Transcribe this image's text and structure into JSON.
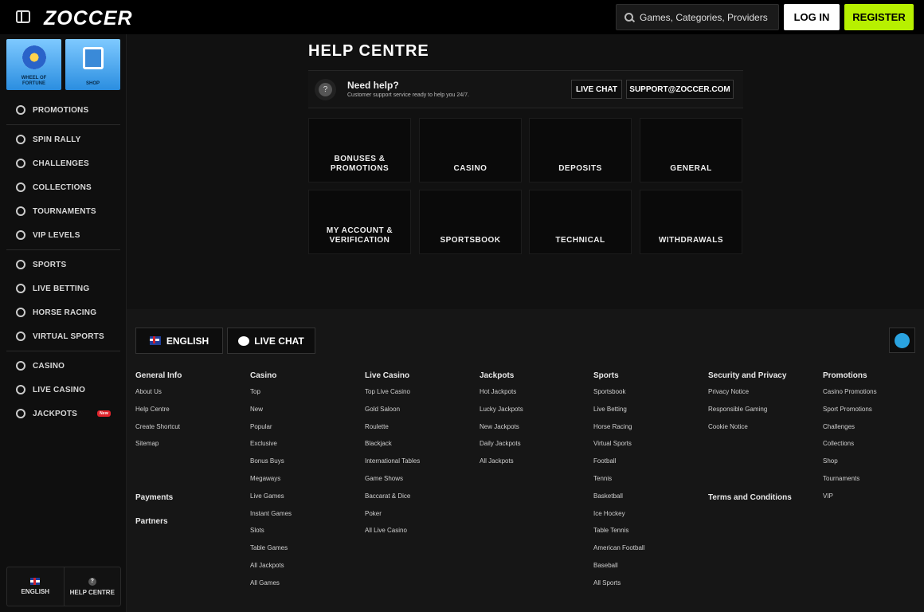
{
  "header": {
    "logo": "ZOCCER",
    "search_placeholder": "Games, Categories, Providers",
    "login": "LOG IN",
    "register": "REGISTER"
  },
  "sidebar": {
    "tiles": [
      {
        "label": "WHEEL OF FORTUNE"
      },
      {
        "label": "SHOP"
      }
    ],
    "groups": [
      [
        {
          "label": "PROMOTIONS",
          "icon": "promotions-icon"
        }
      ],
      [
        {
          "label": "SPIN RALLY",
          "icon": "flag-icon"
        },
        {
          "label": "CHALLENGES",
          "icon": "challenges-icon"
        },
        {
          "label": "COLLECTIONS",
          "icon": "collections-icon"
        },
        {
          "label": "TOURNAMENTS",
          "icon": "tournaments-icon"
        },
        {
          "label": "VIP LEVELS",
          "icon": "vip-icon"
        }
      ],
      [
        {
          "label": "SPORTS",
          "icon": "sports-icon"
        },
        {
          "label": "LIVE BETTING",
          "icon": "live-betting-icon"
        },
        {
          "label": "HORSE RACING",
          "icon": "horse-icon"
        },
        {
          "label": "VIRTUAL SPORTS",
          "icon": "virtual-sports-icon"
        }
      ],
      [
        {
          "label": "CASINO",
          "icon": "casino-icon"
        },
        {
          "label": "LIVE CASINO",
          "icon": "live-casino-icon"
        },
        {
          "label": "JACKPOTS",
          "icon": "jackpots-icon",
          "badge": "New"
        }
      ]
    ],
    "bottom": {
      "language": "ENGLISH",
      "help": "HELP CENTRE"
    }
  },
  "main": {
    "title": "HELP CENTRE",
    "help_box": {
      "title": "Need help?",
      "subtitle": "Customer support service ready to help you 24/7.",
      "live_chat": "LIVE CHAT",
      "email": "SUPPORT@ZOCCER.COM"
    },
    "categories": [
      "BONUSES & PROMOTIONS",
      "CASINO",
      "DEPOSITS",
      "GENERAL",
      "MY ACCOUNT & VERIFICATION",
      "SPORTSBOOK",
      "TECHNICAL",
      "WITHDRAWALS"
    ]
  },
  "footer": {
    "language": "ENGLISH",
    "live_chat": "LIVE CHAT",
    "columns": [
      {
        "title": "General Info",
        "links": [
          "About Us",
          "Help Centre",
          "Create Shortcut",
          "Sitemap"
        ]
      },
      {
        "title": "Casino",
        "links": [
          "Top",
          "New",
          "Popular",
          "Exclusive",
          "Bonus Buys",
          "Megaways",
          "Live Games",
          "Instant Games",
          "Slots",
          "Table Games",
          "All Jackpots",
          "All Games"
        ]
      },
      {
        "title": "Live Casino",
        "links": [
          "Top Live Casino",
          "Gold Saloon",
          "Roulette",
          "Blackjack",
          "International Tables",
          "Game Shows",
          "Baccarat & Dice",
          "Poker",
          "All Live Casino"
        ]
      },
      {
        "title": "Jackpots",
        "links": [
          "Hot Jackpots",
          "Lucky Jackpots",
          "New Jackpots",
          "Daily Jackpots",
          "All Jackpots"
        ]
      },
      {
        "title": "Sports",
        "links": [
          "Sportsbook",
          "Live Betting",
          "Horse Racing",
          "Virtual Sports",
          "Football",
          "Tennis",
          "Basketball",
          "Ice Hockey",
          "Table Tennis",
          "American Football",
          "Baseball",
          "All Sports"
        ]
      },
      {
        "title": "Security and Privacy",
        "links": [
          "Privacy Notice",
          "Responsible Gaming",
          "Cookie Notice"
        ]
      },
      {
        "title": "Promotions",
        "links": [
          "Casino Promotions",
          "Sport Promotions",
          "Challenges",
          "Collections",
          "Shop",
          "Tournaments",
          "VIP"
        ]
      }
    ],
    "extra_heads": {
      "payments": "Payments",
      "partners": "Partners",
      "terms": "Terms and Conditions"
    }
  }
}
